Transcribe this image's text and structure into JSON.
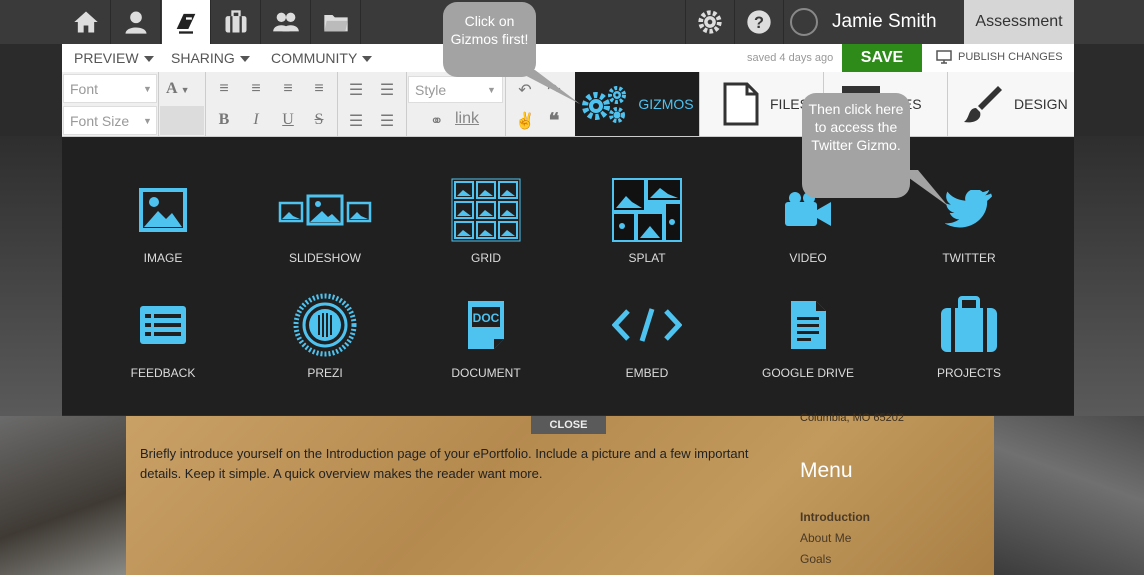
{
  "topnav": {
    "icons": [
      "home-icon",
      "user-icon",
      "editor-icon",
      "briefcase-icon",
      "group-icon",
      "folder-icon"
    ],
    "user_name": "Jamie Smith",
    "section": "Assessment"
  },
  "subnav": {
    "preview": "PREVIEW",
    "sharing": "SHARING",
    "community": "COMMUNITY",
    "saved": "saved 4 days ago",
    "save": "SAVE",
    "publish": "PUBLISH CHANGES"
  },
  "toolbar": {
    "font_placeholder": "Font",
    "font_size_placeholder": "Font Size",
    "style_placeholder": "Style",
    "link": "link",
    "tabs": {
      "gizmos": "GIZMOS",
      "files": "FILES",
      "pages": "GES",
      "design": "DESIGN"
    }
  },
  "gizmos": {
    "row1": [
      "IMAGE",
      "SLIDESHOW",
      "GRID",
      "SPLAT",
      "VIDEO",
      "TWITTER"
    ],
    "row2": [
      "FEEDBACK",
      "PREZI",
      "DOCUMENT",
      "EMBED",
      "GOOGLE DRIVE",
      "PROJECTS"
    ]
  },
  "content": {
    "close": "CLOSE",
    "intro": "Briefly introduce yourself on the Introduction page of your ePortfolio. Include a picture and a few important details. Keep it simple. A quick overview makes the reader want more.",
    "address": "Columbia, MO 65202",
    "menu_title": "Menu",
    "menu_items": [
      "Introduction",
      "About Me",
      "Goals"
    ]
  },
  "tooltips": {
    "first": "Click on Gizmos first!",
    "second": "Then click here to access the Twitter Gizmo."
  },
  "colors": {
    "accent": "#4ec3f0",
    "save": "#2e8b1a",
    "panel": "#202020"
  }
}
